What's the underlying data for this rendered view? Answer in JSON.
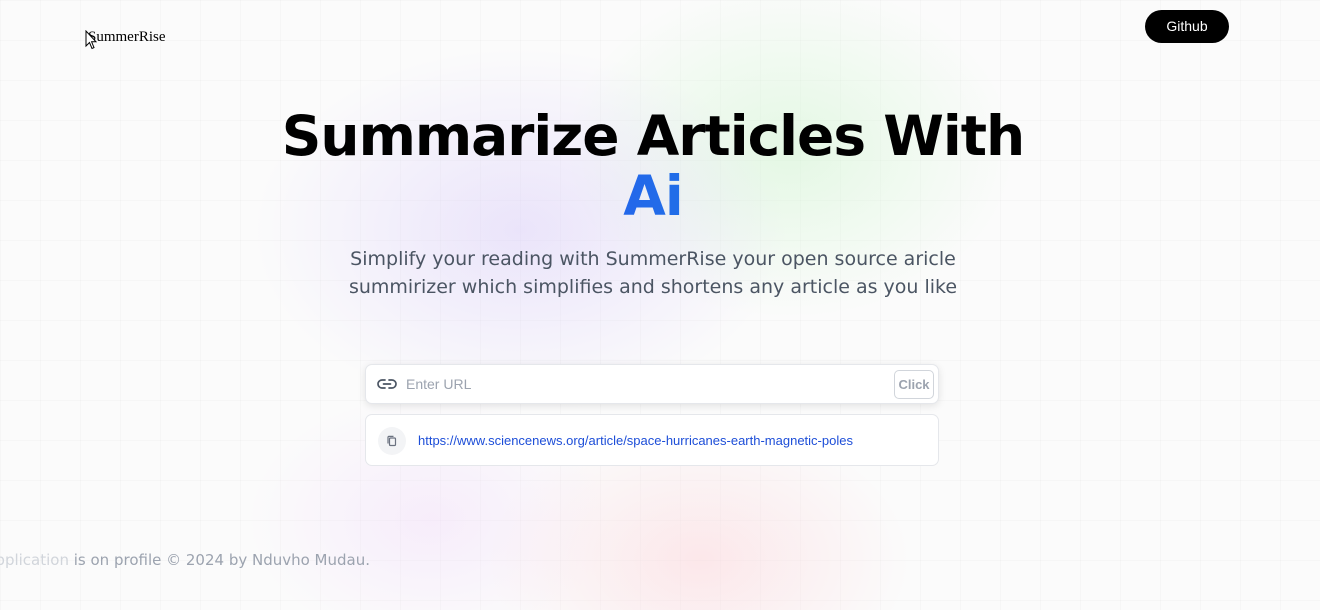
{
  "header": {
    "logo_text": "SummerRise",
    "github_label": "Github"
  },
  "hero": {
    "title_line1": "Summarize Articles With",
    "title_line2": "Ai",
    "description": "Simplify your reading with SummerRise your open source aricle summirizer which simplifies and shortens any article as you like"
  },
  "form": {
    "placeholder": "Enter URL",
    "value": "",
    "submit_label": "Click",
    "link_icon": "link-icon"
  },
  "history": {
    "items": [
      {
        "url": "https://www.sciencenews.org/article/space-hurricanes-earth-magnetic-poles",
        "icon": "copy-icon"
      }
    ]
  },
  "footer": {
    "text_faded": "s application",
    "text": " is on profile © 2024 by Nduvho Mudau."
  },
  "colors": {
    "accent_gradient_start": "#1d4ed8",
    "accent_gradient_end": "#06b6d4",
    "link": "#1d4ed8",
    "button_bg": "#000000"
  }
}
